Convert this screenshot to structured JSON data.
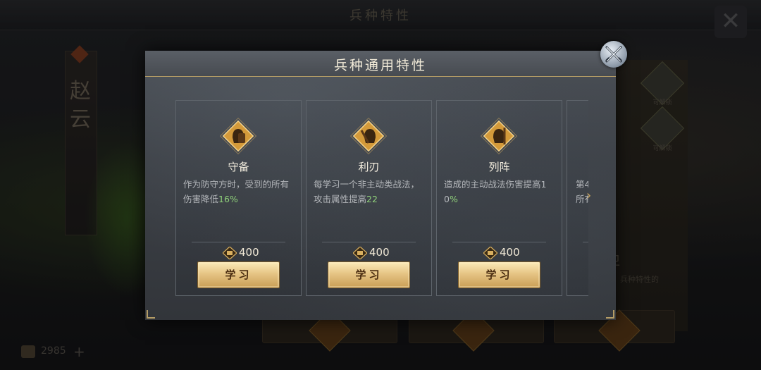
{
  "background": {
    "title": "兵种特性",
    "hero_name": "赵云",
    "side_items": [
      {
        "label": "可解锁"
      },
      {
        "label": "可解锁"
      }
    ],
    "side_title": "卫",
    "side_desc": "兵种特性的",
    "currency_value": "2985",
    "plus_label": "+"
  },
  "modal": {
    "title": "兵种通用特性",
    "close_icon": "crossed-swords-icon",
    "cards": [
      {
        "name": "守备",
        "icon": "helmet-shield-icon",
        "desc_text": "作为防守方时，受到的所有伤害降低",
        "desc_value": "16%",
        "cost_icon": "merit-icon",
        "cost": "400",
        "button": "学习"
      },
      {
        "name": "利刃",
        "icon": "helmet-sword-icon",
        "desc_text": "每学习一个非主动类战法，攻击属性提高",
        "desc_value": "22",
        "cost_icon": "merit-icon",
        "cost": "400",
        "button": "学习"
      },
      {
        "name": "列阵",
        "icon": "helmet-spear-icon",
        "desc_text": "造成的主动战法伤害提高10",
        "desc_value": "%",
        "cost_icon": "merit-icon",
        "cost": "400",
        "button": "学习"
      }
    ],
    "partial_card": {
      "line1": "第4",
      "line2": "所有"
    },
    "accent_color": "#b59d66",
    "value_color": "#8fd07a"
  }
}
